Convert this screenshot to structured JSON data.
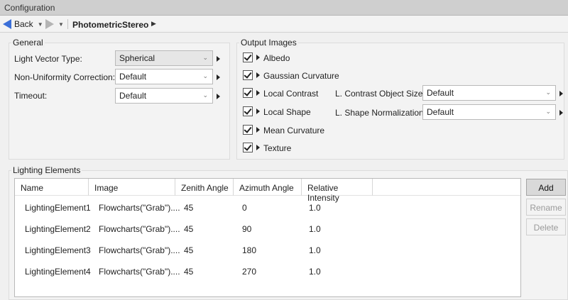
{
  "window": {
    "title": "Configuration"
  },
  "toolbar": {
    "back_label": "Back",
    "breadcrumb": "PhotometricStereo"
  },
  "general": {
    "title": "General",
    "fields": [
      {
        "label": "Light Vector Type:",
        "value": "Spherical",
        "disabled": true
      },
      {
        "label": "Non-Uniformity Correction:",
        "value": "Default",
        "disabled": false
      },
      {
        "label": "Timeout:",
        "value": "Default",
        "disabled": false
      }
    ]
  },
  "output_images": {
    "title": "Output Images",
    "items": [
      {
        "label": "Albedo",
        "checked": true
      },
      {
        "label": "Gaussian Curvature",
        "checked": true
      },
      {
        "label": "Local Contrast",
        "checked": true
      },
      {
        "label": "Local Shape",
        "checked": true
      },
      {
        "label": "Mean Curvature",
        "checked": true
      },
      {
        "label": "Texture",
        "checked": true
      }
    ],
    "extra": [
      {
        "label": "L. Contrast Object Size:",
        "value": "Default"
      },
      {
        "label": "L. Shape Normalization:",
        "value": "Default"
      }
    ]
  },
  "lighting": {
    "title": "Lighting Elements",
    "columns": [
      "Name",
      "Image",
      "Zenith Angle",
      "Azimuth Angle",
      "Relative Intensity"
    ],
    "rows": [
      [
        "LightingElement1",
        "Flowcharts(\"Grab\")....",
        "45",
        "0",
        "1.0"
      ],
      [
        "LightingElement2",
        "Flowcharts(\"Grab\")....",
        "45",
        "90",
        "1.0"
      ],
      [
        "LightingElement3",
        "Flowcharts(\"Grab\")....",
        "45",
        "180",
        "1.0"
      ],
      [
        "LightingElement4",
        "Flowcharts(\"Grab\")....",
        "45",
        "270",
        "1.0"
      ]
    ],
    "buttons": {
      "add": "Add",
      "rename": "Rename",
      "delete": "Delete"
    }
  },
  "colors": {
    "accent": "#3b6fd8"
  }
}
